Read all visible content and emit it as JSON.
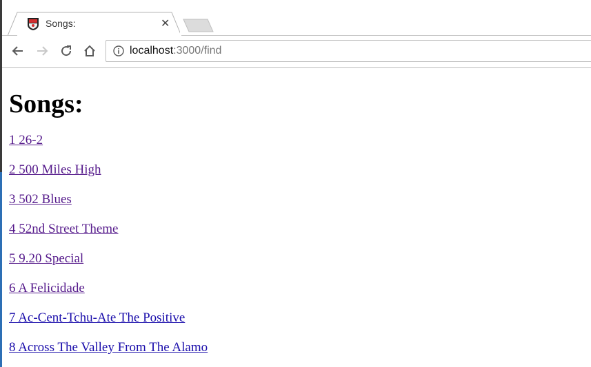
{
  "browser": {
    "tab": {
      "title": "Songs:"
    },
    "address": {
      "host": "localhost",
      "rest": ":3000/find"
    }
  },
  "page": {
    "heading": "Songs:",
    "songs": [
      {
        "label": "1 26-2",
        "visited": true
      },
      {
        "label": "2 500 Miles High",
        "visited": true
      },
      {
        "label": "3 502 Blues",
        "visited": true
      },
      {
        "label": "4 52nd Street Theme",
        "visited": true
      },
      {
        "label": "5 9.20 Special",
        "visited": true
      },
      {
        "label": "6 A Felicidade",
        "visited": true
      },
      {
        "label": "7 Ac-Cent-Tchu-Ate The Positive",
        "visited": false
      },
      {
        "label": "8 Across The Valley From The Alamo",
        "visited": false
      }
    ]
  },
  "colors": {
    "visited_link": "#551a8b",
    "unvisited_link": "#1a0dab"
  },
  "icons": {
    "favicon": "shield-favicon-icon",
    "back": "back-arrow-icon",
    "forward": "forward-arrow-icon",
    "reload": "reload-icon",
    "home": "home-icon",
    "info": "info-icon",
    "close": "close-icon"
  }
}
